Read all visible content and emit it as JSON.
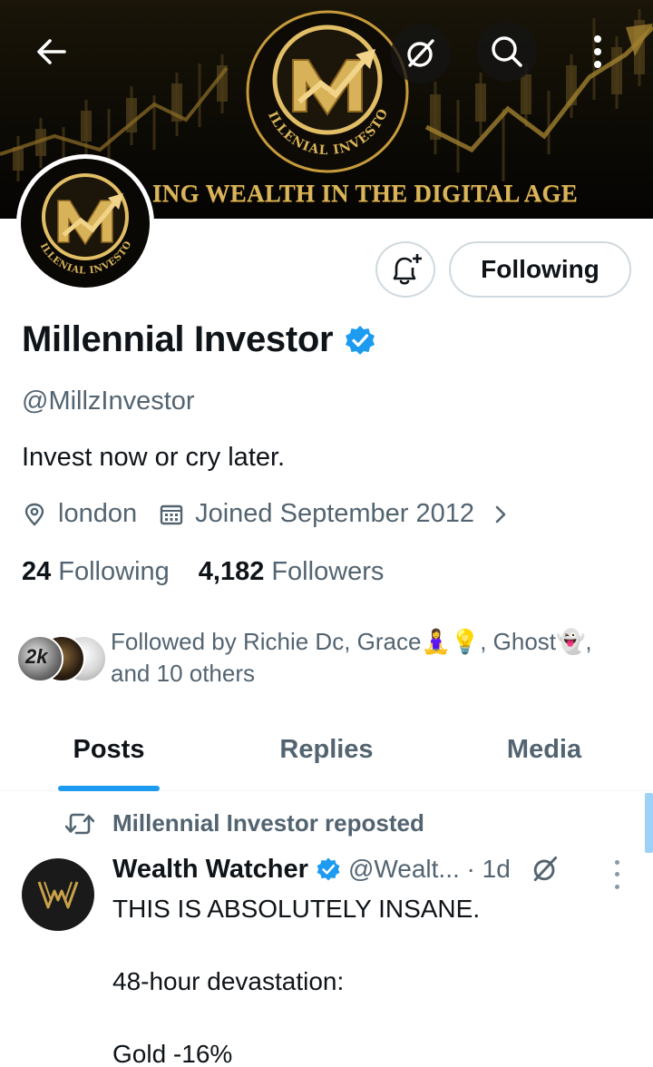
{
  "banner": {
    "logo_text": "MILLENIAL INVESTOR",
    "tagline": "ING WEALTH IN THE DIGITAL AGE"
  },
  "top_bar": {
    "back_icon": "arrow-left-icon",
    "grok_icon": "grok-icon",
    "search_icon": "search-icon",
    "more_icon": "more-vertical-icon"
  },
  "avatar": {
    "logo_text": "MILLENIAL INVESTOR"
  },
  "actions": {
    "notify_icon": "bell-plus-icon",
    "following_label": "Following"
  },
  "profile": {
    "display_name": "Millennial Investor",
    "handle": "@MillzInvestor",
    "bio": "Invest now or cry later.",
    "location": "london",
    "joined": "Joined September 2012",
    "verified_color": "#1d9bf0"
  },
  "stats": {
    "following_count": "24",
    "following_label": "Following",
    "followers_count": "4,182",
    "followers_label": "Followers"
  },
  "followed_by": {
    "text": "Followed by Richie Dc, Grace🧘‍♀️💡, Ghost👻, and 10 others",
    "avatar_label": "2k"
  },
  "tabs": [
    {
      "label": "Posts",
      "active": true
    },
    {
      "label": "Replies",
      "active": false
    },
    {
      "label": "Media",
      "active": false
    }
  ],
  "post": {
    "repost_label": "Millennial Investor reposted",
    "author": "Wealth Watcher",
    "handle_time": "@Wealt... · 1d",
    "lines": [
      "THIS IS ABSOLUTELY INSANE.",
      "48-hour devastation:",
      "Gold -16%"
    ]
  },
  "colors": {
    "accent": "#1d9bf0",
    "gold": "#d9b45a",
    "text_primary": "#0f1419",
    "text_secondary": "#536471"
  }
}
